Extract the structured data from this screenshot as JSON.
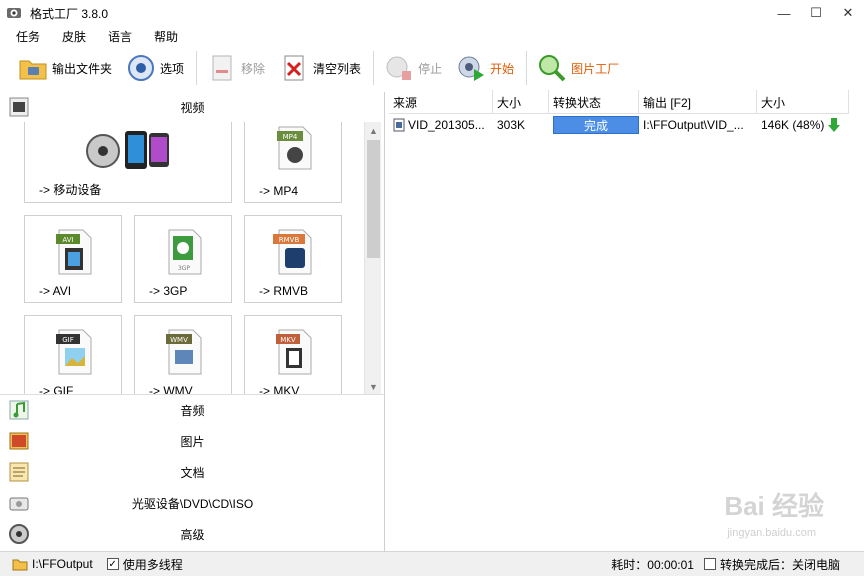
{
  "window": {
    "title": "格式工厂 3.8.0",
    "minimize": "—",
    "maximize": "☐",
    "close": "✕"
  },
  "menu": [
    {
      "label": "任务"
    },
    {
      "label": "皮肤"
    },
    {
      "label": "语言"
    },
    {
      "label": "帮助"
    }
  ],
  "toolbar": {
    "output_folder": "输出文件夹",
    "options": "选项",
    "remove": "移除",
    "clear_list": "清空列表",
    "stop": "停止",
    "start": "开始",
    "picture_factory": "图片工厂"
  },
  "categories": {
    "video": "视频",
    "audio": "音频",
    "picture": "图片",
    "document": "文档",
    "disc": "光驱设备\\DVD\\CD\\ISO",
    "advanced": "高级"
  },
  "tiles": [
    {
      "label": "-> 移动设备",
      "badge": ""
    },
    {
      "label": "-> MP4",
      "badge": "MP4"
    },
    {
      "label": "-> AVI",
      "badge": "AVI"
    },
    {
      "label": "-> 3GP",
      "badge": "3GP"
    },
    {
      "label": "-> RMVB",
      "badge": "RMVB"
    },
    {
      "label": "-> GIF",
      "badge": "GIF"
    },
    {
      "label": "-> WMV",
      "badge": "WMV"
    },
    {
      "label": "-> MKV",
      "badge": "MKV"
    }
  ],
  "table": {
    "headers": [
      "来源",
      "大小",
      "转换状态",
      "输出 [F2]",
      "大小"
    ],
    "rows": [
      {
        "source": "VID_201305...",
        "size": "303K",
        "status": "完成",
        "output": "I:\\FFOutput\\VID_...",
        "out_size": "146K  (48%)"
      }
    ]
  },
  "statusbar": {
    "output_path": "I:\\FFOutput",
    "multithread": "使用多线程",
    "elapsed": "耗时：00:00:01",
    "after_convert": "转换完成后：关闭电脑"
  },
  "watermark": {
    "main": "Bai 经验",
    "sub": "jingyan.baidu.com"
  },
  "colors": {
    "status_blue": "#4c8ee6",
    "start_orange": "#e05a00",
    "down_arrow": "#2ea836"
  }
}
